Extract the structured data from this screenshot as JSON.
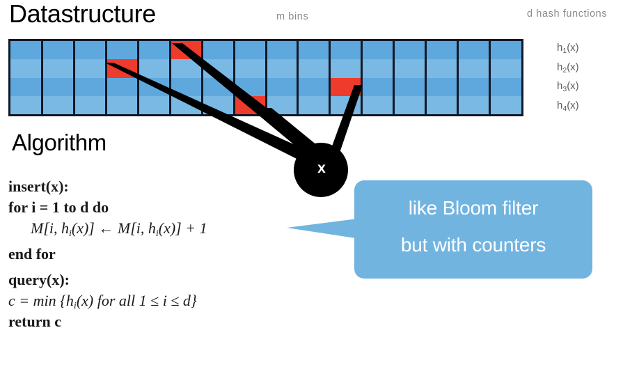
{
  "slide": {
    "section_title": "Datastructure",
    "algorithm_title": "Algorithm"
  },
  "annotations": {
    "m_bins": "m bins",
    "d_hash_functions": "d hash functions"
  },
  "matrix": {
    "columns": 16,
    "rows": 4,
    "row_colors": [
      "#5fa8dd",
      "#79b9e4",
      "#5fa8dd",
      "#79b9e4"
    ],
    "border_color": "#111827",
    "highlight_color": "#ef3b2c",
    "highlighted_cells": [
      {
        "row": 1,
        "col": 6
      },
      {
        "row": 2,
        "col": 4
      },
      {
        "row": 3,
        "col": 11
      },
      {
        "row": 4,
        "col": 8
      }
    ],
    "hash_labels": [
      {
        "name": "h",
        "sub": "1",
        "arg": "(x)"
      },
      {
        "name": "h",
        "sub": "2",
        "arg": "(x)"
      },
      {
        "name": "h",
        "sub": "3",
        "arg": "(x)"
      },
      {
        "name": "h",
        "sub": "4",
        "arg": "(x)"
      }
    ]
  },
  "element_marker": {
    "label": "x",
    "circle_color": "#000000",
    "text_color": "#ffffff"
  },
  "callout": {
    "line1": "like Bloom filter",
    "line2": "but with counters",
    "background": "#72b4e0",
    "text_color": "#ffffff"
  },
  "pseudocode": {
    "insert_header": "insert(x):",
    "insert_for": "for i = 1 to d do",
    "insert_body_pre": "M[i, h",
    "insert_body_sub1": "i",
    "insert_body_mid": "(x)] ← M[i, h",
    "insert_body_sub2": "i",
    "insert_body_post": "(x)] + 1",
    "insert_end": "end for",
    "query_header": "query(x):",
    "query_body_pre": "c = min {h",
    "query_body_sub": "i",
    "query_body_post": "(x) for all 1 ≤ i ≤ d}",
    "query_return": "return c"
  }
}
